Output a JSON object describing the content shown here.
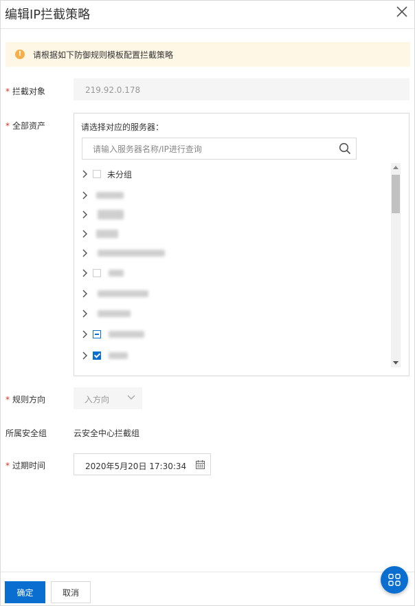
{
  "dialog": {
    "title": "编辑IP拦截策略",
    "close_icon": "close-icon"
  },
  "alert": {
    "icon": "warning-icon",
    "text": "请根据如下防御规则模板配置拦截策略",
    "color": "#f5b04c",
    "background": "#fff7e6"
  },
  "form": {
    "required_mark": "*",
    "target": {
      "label": "拦截对象",
      "value": "219.92.0.178"
    },
    "assets": {
      "label": "全部资产",
      "hint": "请选择对应的服务器：",
      "search_placeholder": "请输入服务器名称/IP进行查询",
      "items": [
        {
          "label": "未分组",
          "state": "unchecked"
        },
        {
          "label": "",
          "state": "none"
        },
        {
          "label": "",
          "state": "none"
        },
        {
          "label": "",
          "state": "none"
        },
        {
          "label": "",
          "state": "none"
        },
        {
          "label": "",
          "state": "unchecked"
        },
        {
          "label": "",
          "state": "none"
        },
        {
          "label": "",
          "state": "none"
        },
        {
          "label": "",
          "state": "partial"
        },
        {
          "label": "",
          "state": "checked"
        }
      ]
    },
    "direction": {
      "label": "规则方向",
      "value": "入方向"
    },
    "security_group": {
      "label": "所属安全组",
      "value": "云安全中心拦截组"
    },
    "expire": {
      "label": "过期时间",
      "value": "2020年5月20日 17:30:34"
    }
  },
  "footer": {
    "confirm_label": "确定",
    "cancel_label": "取消"
  },
  "colors": {
    "primary": "#0a6ed1",
    "required": "#d93026"
  }
}
